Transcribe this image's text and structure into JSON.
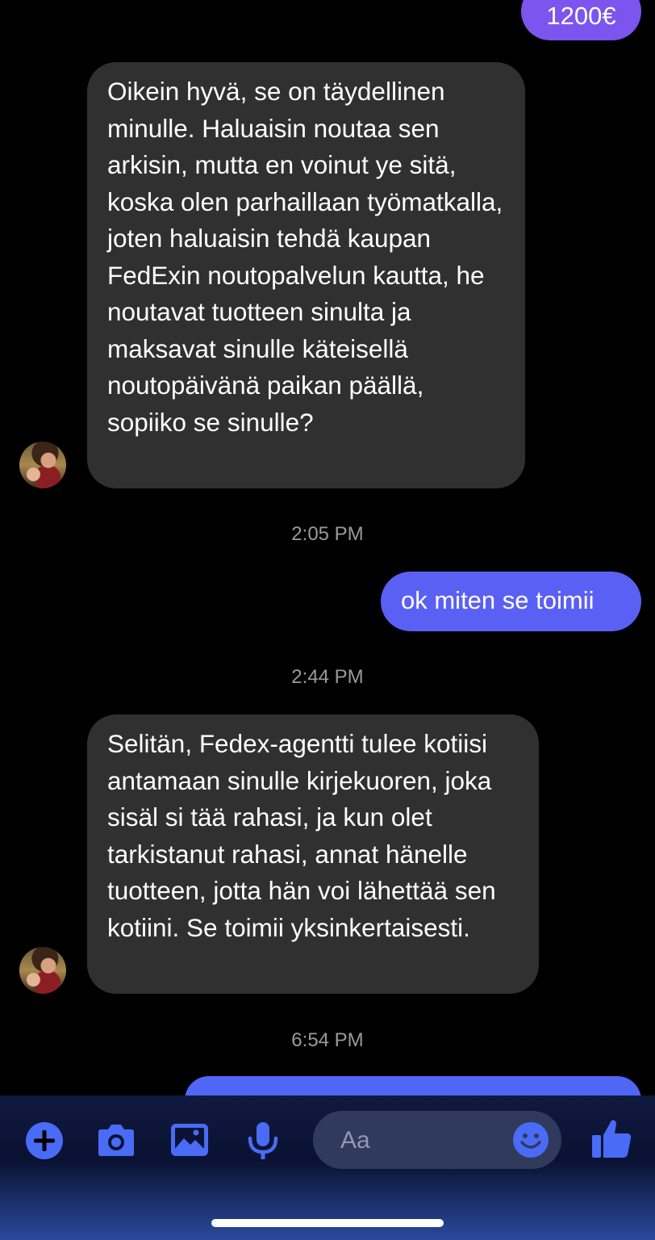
{
  "messages": {
    "top_out": "1200€",
    "in_1": "Oikein hyvä, se on täydellinen minulle. Haluaisin noutaa sen arkisin, mutta en voinut ye sitä, koska olen parhaillaan työmatkalla, joten haluaisin tehdä kaupan FedExin noutopalvelun kautta, he noutavat tuotteen sinulta ja maksavat sinulle käteisellä noutopäivänä paikan päällä, sopiiko se sinulle?",
    "out_2": "ok miten se toimii",
    "in_2": "Selitän, Fedex-agentti tulee kotiisi antamaan sinulle kirjekuoren, joka sisäl si tää rahasi, ja kun olet tarkistanut rahasi, annat hänelle tuotteen, jotta hän voi lähettää sen kotiini. Se toimii yksinkertaisesti."
  },
  "timestamps": {
    "t1": "2:05 PM",
    "t2": "2:44 PM",
    "t3": "6:54 PM"
  },
  "composer": {
    "placeholder": "Aa"
  },
  "colors": {
    "accent": "#4a6bf5",
    "outgoing_purple": "#7b55ee",
    "outgoing_blue": "#5a60f4",
    "incoming": "#303030"
  }
}
